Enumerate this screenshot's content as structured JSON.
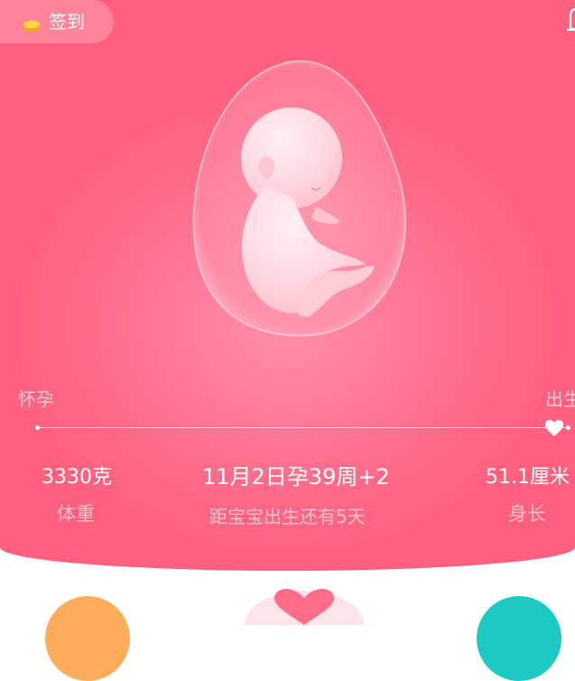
{
  "header": {
    "checkin_label": "签到",
    "checkin_icon": "coin-icon",
    "notification_icon": "bell-icon"
  },
  "progress": {
    "start_label": "怀孕",
    "end_label": "出生",
    "fraction": 0.97
  },
  "stats": {
    "weight_value": "3330克",
    "weight_label": "体重",
    "date_week": "11月2日孕39周+2",
    "countdown": "距宝宝出生还有5天",
    "length_value": "51.1厘米",
    "length_label": "身长"
  },
  "colors": {
    "hero_pink": "#ff6683",
    "orange": "#ffad5c",
    "teal": "#1cc9c3"
  }
}
